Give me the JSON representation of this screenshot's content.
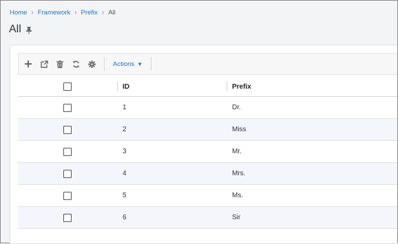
{
  "breadcrumb": {
    "items": [
      "Home",
      "Framework",
      "Prefix"
    ],
    "current": "All",
    "separator": "›"
  },
  "page": {
    "title": "All",
    "pin_icon": "pin-icon"
  },
  "toolbar": {
    "icons": [
      "add-icon",
      "open-external-icon",
      "delete-icon",
      "refresh-icon",
      "settings-icon"
    ],
    "actions_label": "Actions",
    "actions_caret": "▼"
  },
  "table": {
    "headers": {
      "id": "ID",
      "prefix": "Prefix"
    },
    "rows": [
      {
        "id": "1",
        "prefix": "Dr."
      },
      {
        "id": "2",
        "prefix": "Miss"
      },
      {
        "id": "3",
        "prefix": "Mr."
      },
      {
        "id": "4",
        "prefix": "Mrs."
      },
      {
        "id": "5",
        "prefix": "Ms."
      },
      {
        "id": "6",
        "prefix": "Sir"
      }
    ]
  },
  "colors": {
    "link": "#1d75c4",
    "icon": "#666666",
    "row_alt": "#f4f6fb"
  }
}
